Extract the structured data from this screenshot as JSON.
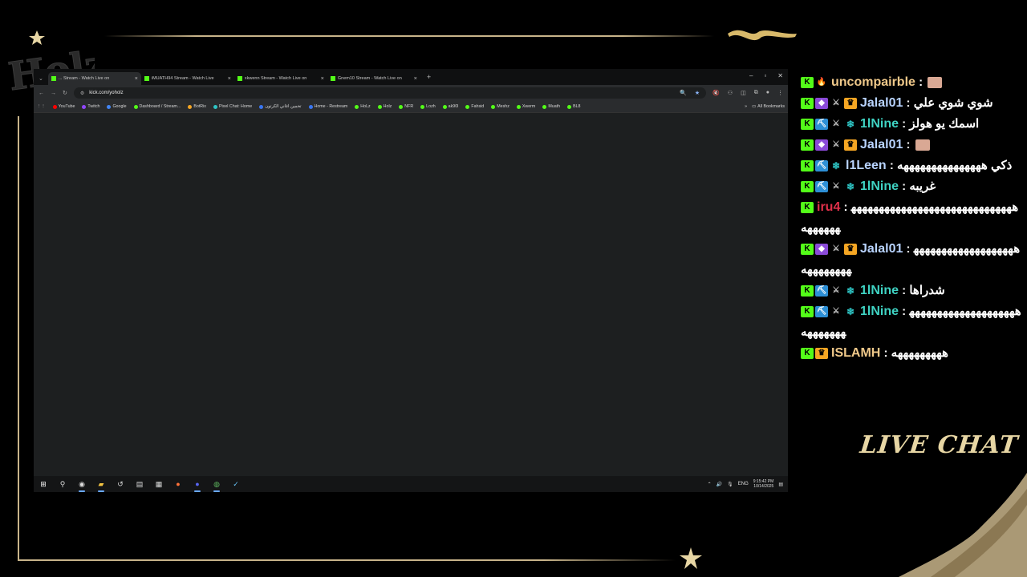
{
  "colors": {
    "gold": "#c8b48a",
    "kick_green": "#53fc18",
    "chat_label": "#e7d6a4"
  },
  "overlay": {
    "logo_text": "HOLZ",
    "live_chat_label": "LIVE CHAT"
  },
  "browser": {
    "tabs": [
      {
        "title": "... Stream - Watch Live on",
        "active": true
      },
      {
        "title": "iMUATH94 Stream - Watch Live",
        "active": false
      },
      {
        "title": "xkwenn Stream - Watch Live on",
        "active": false
      },
      {
        "title": "Gnem10 Stream - Watch Live on",
        "active": false
      }
    ],
    "address": "kick.com/yoholz",
    "bookmarks": [
      "YouTube",
      "Twitch",
      "Google",
      "Dashboard / Stream...",
      "BotRix",
      "Pixel Chat: Home",
      "تخمين اغاني الكرتون",
      "Home - Restream",
      "HoLz",
      "Holz",
      "NFR",
      "Lozh",
      "ak90l",
      "Fahsid",
      "Meshz",
      "Xwerm",
      "Muath",
      "BL8"
    ],
    "all_bookmarks": "All Bookmarks"
  },
  "taskbar": {
    "lang": "ENG",
    "time": "9:15:42 PM",
    "date": "10/14/2025"
  },
  "chat": {
    "messages": [
      {
        "user": "uncompairble",
        "user_color": "#f0c98a",
        "badges": [
          "k",
          "flame"
        ],
        "text": "",
        "emote": true
      },
      {
        "user": "Jalal01",
        "user_color": "#b9d4ff",
        "badges": [
          "k",
          "purple",
          "sword",
          "crown"
        ],
        "text": "شوي شوي علي",
        "emote": false
      },
      {
        "user": "1lNine",
        "user_color": "#3fd3c3",
        "badges": [
          "k",
          "pick",
          "sword",
          "vip"
        ],
        "text": "اسمك يو هولز",
        "emote": false
      },
      {
        "user": "Jalal01",
        "user_color": "#b9d4ff",
        "badges": [
          "k",
          "purple",
          "sword",
          "crown"
        ],
        "text": "",
        "emote": true
      },
      {
        "user": "l1Leen",
        "user_color": "#b9d4ff",
        "badges": [
          "k",
          "pick",
          "vip"
        ],
        "text": "ذكي هههههههههههههههه",
        "emote": false
      },
      {
        "user": "1lNine",
        "user_color": "#3fd3c3",
        "badges": [
          "k",
          "pick",
          "sword",
          "vip"
        ],
        "text": "غريبه",
        "emote": false
      },
      {
        "user": "iru4",
        "user_color": "#e0304a",
        "badges": [
          "k"
        ],
        "text": "ههههههههههههههههههههههههههههههههههههه",
        "emote": false
      },
      {
        "user": "Jalal01",
        "user_color": "#b9d4ff",
        "badges": [
          "k",
          "purple",
          "sword",
          "crown"
        ],
        "text": "هههههههههههههههههههههههههههه",
        "emote": false
      },
      {
        "user": "1lNine",
        "user_color": "#3fd3c3",
        "badges": [
          "k",
          "pick",
          "sword",
          "vip"
        ],
        "text": "شدراها",
        "emote": false
      },
      {
        "user": "1lNine",
        "user_color": "#3fd3c3",
        "badges": [
          "k",
          "pick",
          "sword",
          "vip"
        ],
        "text": "هههههههههههههههههههههههههههه",
        "emote": false
      },
      {
        "user": "ISLAMH",
        "user_color": "#f0c98a",
        "badges": [
          "k",
          "crown"
        ],
        "text": "هههههههههه",
        "emote": false
      }
    ]
  }
}
